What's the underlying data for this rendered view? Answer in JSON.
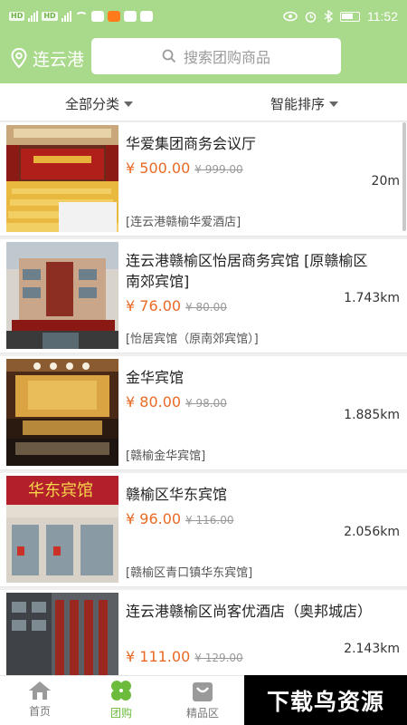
{
  "status_bar": {
    "left_chips": [
      "HD",
      "4G",
      "HD",
      "4G"
    ],
    "time": "11:52"
  },
  "header": {
    "city": "连云港",
    "search_placeholder": "搜索团购商品"
  },
  "filters": {
    "category": "全部分类",
    "sort": "智能排序"
  },
  "listings": [
    {
      "name": "华爱集团商务会议厅",
      "price": "¥ 500.00",
      "original_price": "¥ 999.00",
      "distance": "20m",
      "address": "[连云港赣榆华爱酒店]"
    },
    {
      "name": "连云港赣榆区怡居商务宾馆 [原赣榆区南郊宾馆]",
      "price": "¥ 76.00",
      "original_price": "¥ 80.00",
      "distance": "1.743km",
      "address": "[怡居宾馆（原南郊宾馆）]"
    },
    {
      "name": "金华宾馆",
      "price": "¥ 80.00",
      "original_price": "¥ 98.00",
      "distance": "1.885km",
      "address": "[赣榆金华宾馆]"
    },
    {
      "name": "赣榆区华东宾馆",
      "price": "¥ 96.00",
      "original_price": "¥ 116.00",
      "distance": "2.056km",
      "address": "[赣榆区青口镇华东宾馆]"
    },
    {
      "name": "连云港赣榆区尚客优酒店（奥邦城店）",
      "price": "¥ 111.00",
      "original_price": "¥ 129.00",
      "distance": "2.143km",
      "address": ""
    }
  ],
  "thumb_signs": {
    "hotel2_sign": "华东宾馆"
  },
  "bottom_nav": [
    {
      "label": "首页",
      "icon": "home-icon",
      "active": false
    },
    {
      "label": "团购",
      "icon": "clover-icon",
      "active": true
    },
    {
      "label": "精品区",
      "icon": "bag-icon",
      "active": false
    }
  ],
  "watermark": "下载鸟资源",
  "colors": {
    "header_green": "#a9d98a",
    "price_orange": "#e86a25",
    "active_green": "#6dbb3c"
  }
}
